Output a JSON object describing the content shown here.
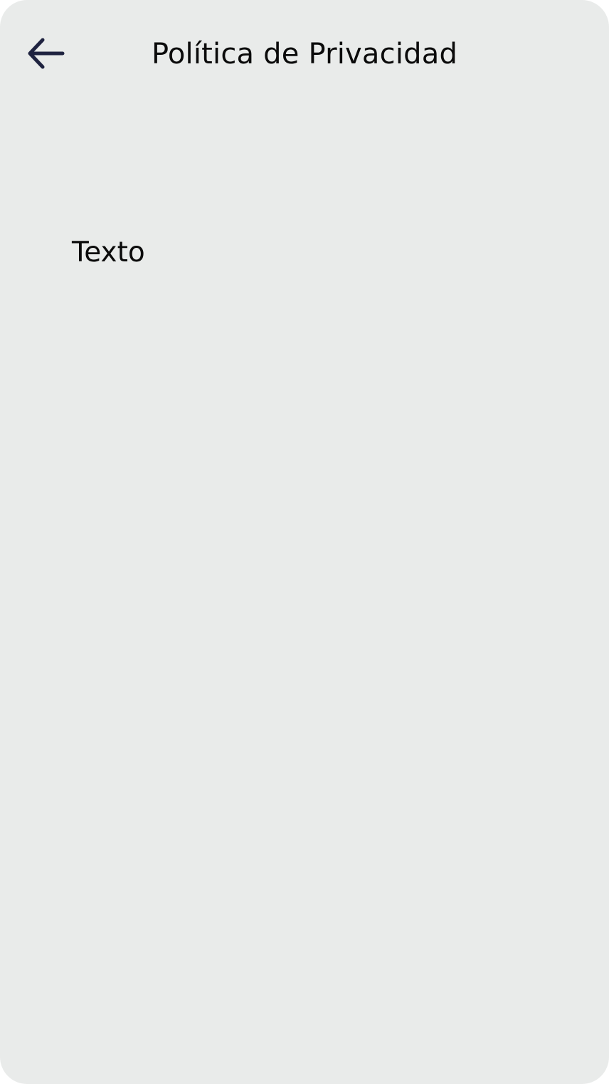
{
  "header": {
    "title": "Política de Privacidad",
    "back_icon": "arrow-left-icon"
  },
  "content": {
    "text": "Texto"
  },
  "colors": {
    "background": "#e9ebea",
    "icon": "#1f2340",
    "text": "#0b0b0b"
  }
}
